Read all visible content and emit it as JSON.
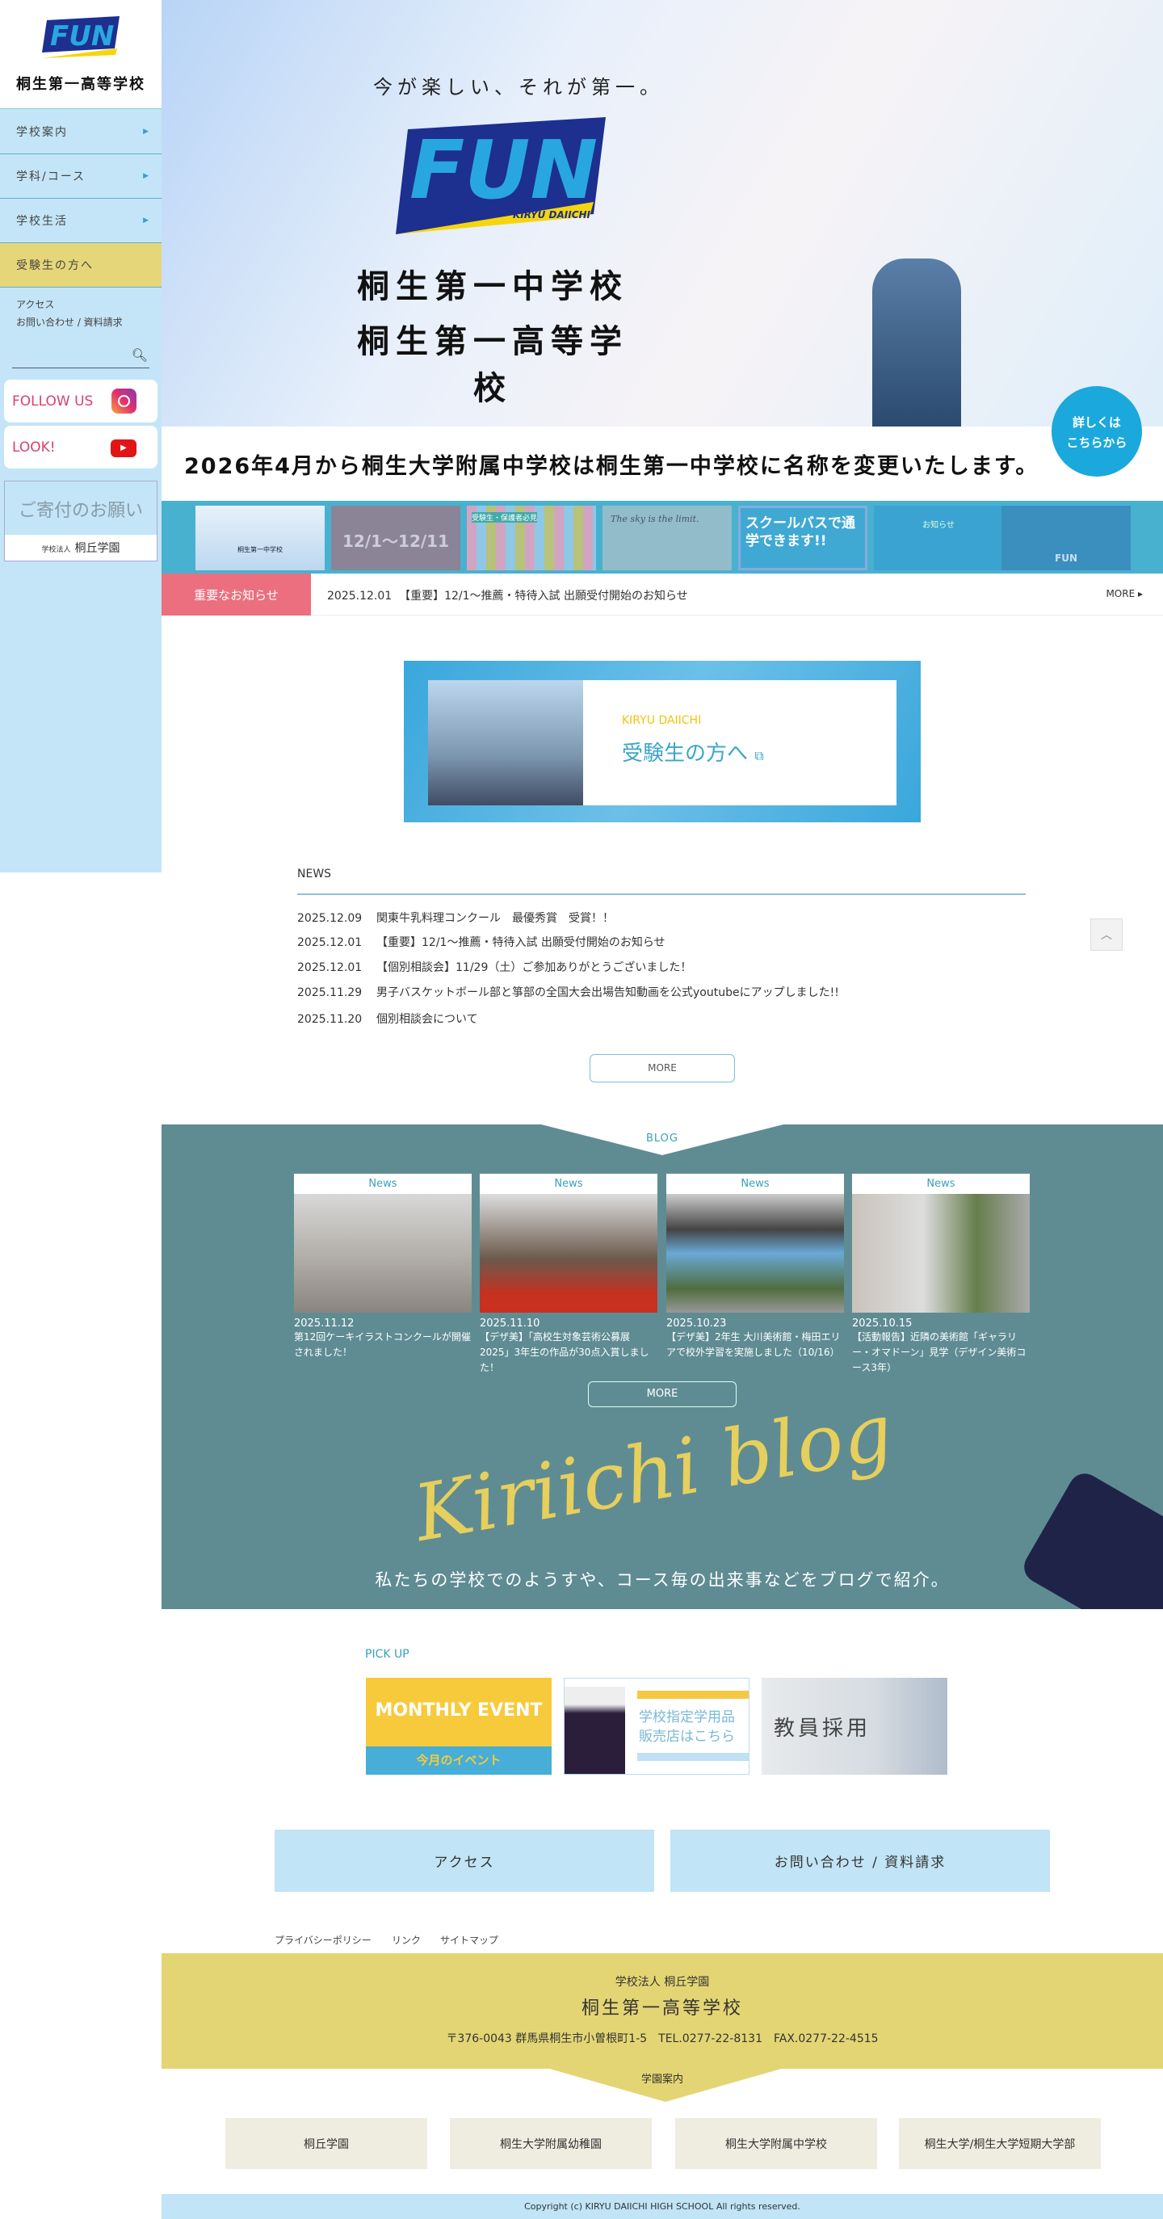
{
  "sidebar": {
    "logo_text": "FUN",
    "logo_sub": "KIRYU DAIICHI",
    "school_name": "桐生第一高等学校",
    "nav": [
      {
        "label": "学校案内"
      },
      {
        "label": "学科/コース"
      },
      {
        "label": "学校生活"
      },
      {
        "label": "受験生の方へ"
      }
    ],
    "links": [
      "アクセス",
      "お問い合わせ / 資料請求"
    ],
    "follow_label": "FOLLOW US",
    "look_label": "LOOK!",
    "donation_label": "ご寄付のお願い",
    "donation_org_prefix": "学校法人",
    "donation_org": "桐丘学園"
  },
  "hero": {
    "tagline": "今が楽しい、それが第一。",
    "logo_text": "FUN",
    "logo_sub": "KIRYU DAIICHI",
    "title1": "桐生第一中学校",
    "title2": "桐生第一高等学校",
    "cta_line1": "詳しくは",
    "cta_line2": "こちらから"
  },
  "headline": "2026年4月から桐生大学附属中学校は桐生第一中学校に名称を変更いたします。",
  "banners": [
    {
      "text": "桐生第一中学校"
    },
    {
      "text": "12/1〜12/11"
    },
    {
      "text": "受験生・保護者必見"
    },
    {
      "text": "The sky is the limit."
    },
    {
      "text": "スクールバスで通学できます!!"
    },
    {
      "text": "お知らせ"
    },
    {
      "text": "FUN"
    }
  ],
  "notice": {
    "label": "重要なお知らせ",
    "date": "2025.12.01",
    "text": "【重要】12/1〜推薦・特待入試 出願受付開始のお知らせ",
    "more": "MORE ▸"
  },
  "admissions": {
    "sub": "KIRYU DAIICHI",
    "title": "受験生の方へ"
  },
  "news": {
    "title": "NEWS",
    "items": [
      {
        "date": "2025.12.09",
        "text": "関東牛乳料理コンクール　最優秀賞　受賞！！"
      },
      {
        "date": "2025.12.01",
        "text": "【重要】12/1〜推薦・特待入試 出願受付開始のお知らせ"
      },
      {
        "date": "2025.12.01",
        "text": "【個別相談会】11/29（土）ご参加ありがとうございました！"
      },
      {
        "date": "2025.11.29",
        "text": "男子バスケットボール部と箏部の全国大会出場告知動画を公式youtubeにアップしました!!"
      },
      {
        "date": "2025.11.20",
        "text": "個別相談会について"
      }
    ],
    "more": "MORE"
  },
  "blog": {
    "title": "BLOG",
    "cards": [
      {
        "category": "News",
        "date": "2025.11.12",
        "text": "第12回ケーキイラストコンクールが開催されました！"
      },
      {
        "category": "News",
        "date": "2025.11.10",
        "text": "【デザ美】「高校生対象芸術公募展2025」3年生の作品が30点入賞しました！"
      },
      {
        "category": "News",
        "date": "2025.10.23",
        "text": "【デザ美】2年生 大川美術館・梅田エリアで校外学習を実施しました（10/16）"
      },
      {
        "category": "News",
        "date": "2025.10.15",
        "text": "【活動報告】近隣の美術館「ギャラリー・オマドーン」見学（デザイン美術コース3年）"
      }
    ],
    "more": "MORE",
    "script": "Kiriichi blog",
    "caption": "私たちの学校でのようすや、コース毎の出来事などをブログで紹介。"
  },
  "pickup": {
    "title": "PICK UP",
    "monthly_title": "MONTHLY EVENT",
    "monthly_sub": "今月のイベント",
    "uniform_line1": "学校指定学用品",
    "uniform_line2": "販売店はこちら",
    "recruit": "教員採用"
  },
  "buttons": {
    "access": "アクセス",
    "contact": "お問い合わせ / 資料請求"
  },
  "footer": {
    "links": [
      "プライバシーポリシー",
      "リンク",
      "サイトマップ"
    ],
    "org": "学校法人  桐丘学園",
    "school": "桐生第一高等学校",
    "address": "〒376-0043 群馬県桐生市小曽根町1-5　TEL.0277-22-8131　FAX.0277-22-4515",
    "group_label": "学園案内",
    "group": [
      "桐丘学園",
      "桐生大学附属幼稚園",
      "桐生大学附属中学校",
      "桐生大学/桐生大学短期大学部"
    ],
    "copyright": "Copyright (c) KIRYU DAIICHI HIGH SCHOOL All rights reserved."
  }
}
